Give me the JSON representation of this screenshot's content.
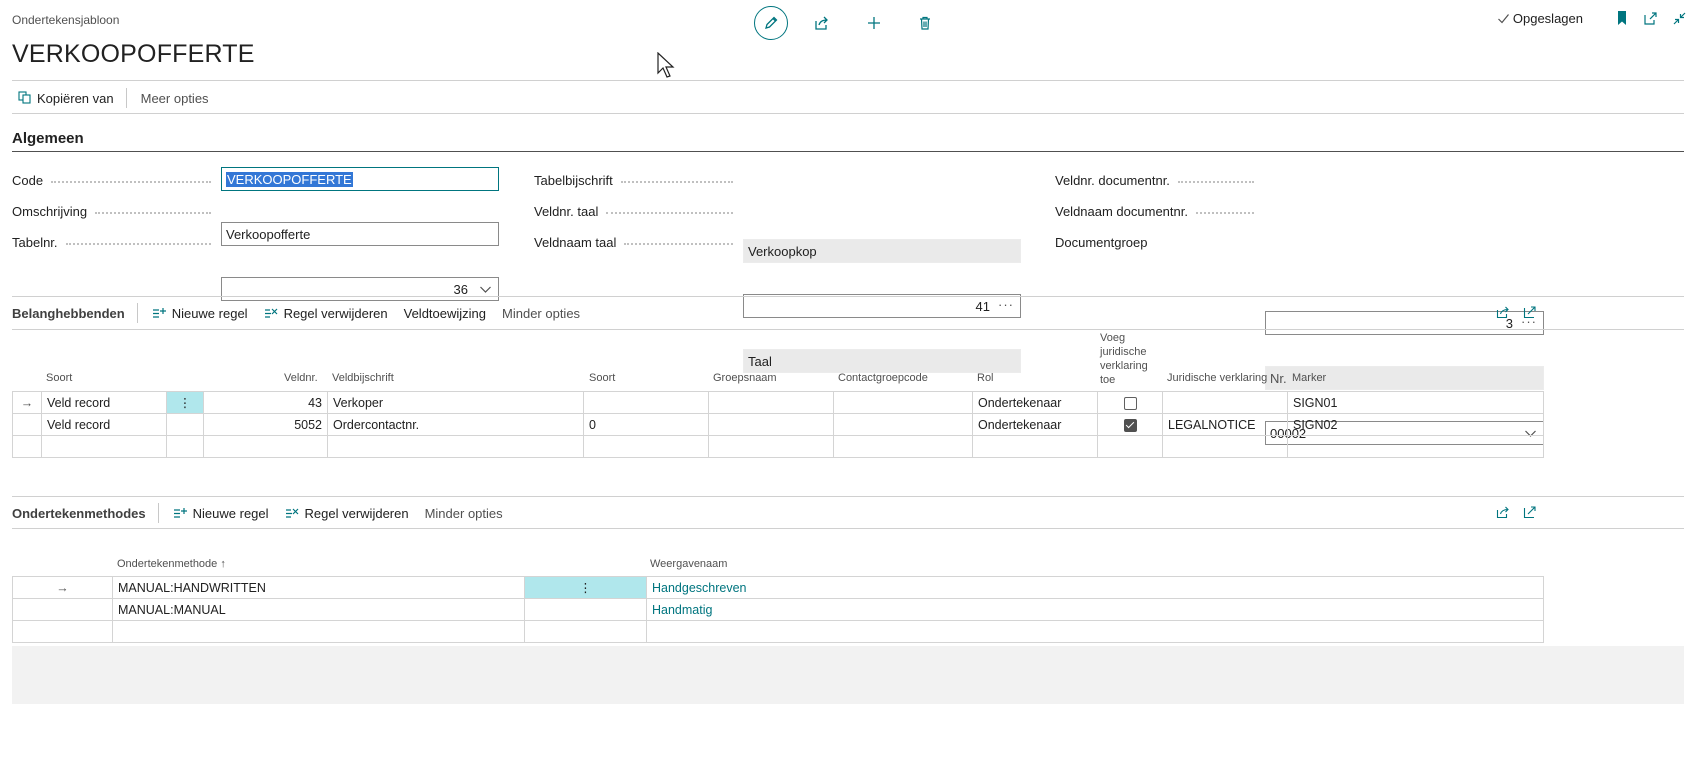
{
  "header": {
    "caption": "Ondertekensjabloon",
    "title": "VERKOOPOFFERTE",
    "saved_status": "Opgeslagen"
  },
  "toolbar": {
    "copy_from": "Kopiëren van",
    "more_options": "Meer opties"
  },
  "general": {
    "title": "Algemeen",
    "fields": {
      "code": {
        "label": "Code",
        "value": "VERKOOPOFFERTE"
      },
      "description": {
        "label": "Omschrijving",
        "value": "Verkoopofferte"
      },
      "table_no": {
        "label": "Tabelnr.",
        "value": "36"
      },
      "table_caption": {
        "label": "Tabelbijschrift",
        "value": "Verkoopkop"
      },
      "field_no_lang": {
        "label": "Veldnr. taal",
        "value": "41"
      },
      "field_name_lang": {
        "label": "Veldnaam taal",
        "value": "Taal"
      },
      "field_no_docno": {
        "label": "Veldnr. documentnr.",
        "value": "3"
      },
      "field_name_docno": {
        "label": "Veldnaam documentnr.",
        "value": "Nr."
      },
      "doc_group": {
        "label": "Documentgroep",
        "value": "00002"
      }
    }
  },
  "stakeholders": {
    "title": "Belanghebbenden",
    "actions": {
      "new_line": "Nieuwe regel",
      "delete_line": "Regel verwijderen",
      "field_assign": "Veldtoewijzing",
      "fewer_options": "Minder opties"
    },
    "columns": {
      "soort": "Soort",
      "veldnr": "Veldnr.",
      "veldbijschrift": "Veldbijschrift",
      "soort2": "Soort",
      "groepsnaam": "Groepsnaam",
      "contactgroepcode": "Contactgroepcode",
      "rol": "Rol",
      "voeg_1": "Voeg",
      "voeg_2": "juridische",
      "voeg_3": "verklaring",
      "voeg_4": "toe",
      "juridische_verklaring": "Juridische verklaring",
      "marker": "Marker"
    },
    "rows": [
      {
        "soort": "Veld record",
        "veldnr": "43",
        "veldbijschrift": "Verkoper",
        "soort2": "",
        "groepsnaam": "",
        "contactgroepcode": "",
        "rol": "Ondertekenaar",
        "add_legal": false,
        "legal": "",
        "marker": "SIGN01"
      },
      {
        "soort": "Veld record",
        "veldnr": "5052",
        "veldbijschrift": "Ordercontactnr.",
        "soort2": "0",
        "groepsnaam": "",
        "contactgroepcode": "",
        "rol": "Ondertekenaar",
        "add_legal": true,
        "legal": "LEGALNOTICE",
        "marker": "SIGN02"
      }
    ]
  },
  "methods": {
    "title": "Ondertekenmethodes",
    "actions": {
      "new_line": "Nieuwe regel",
      "delete_line": "Regel verwijderen",
      "fewer_options": "Minder opties"
    },
    "columns": {
      "method": "Ondertekenmethode",
      "display_name": "Weergavenaam"
    },
    "rows": [
      {
        "method": "MANUAL:HANDWRITTEN",
        "display_name": "Handgeschreven"
      },
      {
        "method": "MANUAL:MANUAL",
        "display_name": "Handmatig"
      }
    ]
  },
  "colors": {
    "accent": "#00757f",
    "highlight": "#b0e7ec",
    "selection": "#3377d6"
  }
}
